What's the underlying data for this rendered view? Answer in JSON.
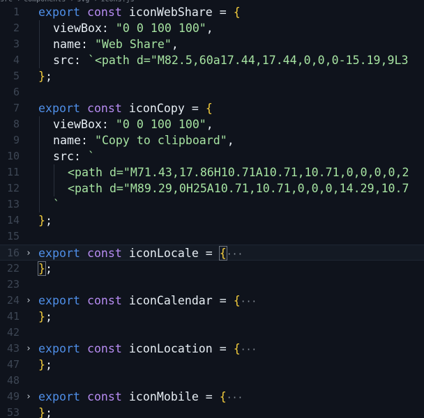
{
  "breadcrumb": [
    "src",
    "components",
    "svg",
    "icons.js"
  ],
  "lines": [
    {
      "n": "1",
      "tokens": [
        [
          "kw",
          "export"
        ],
        [
          "sp",
          " "
        ],
        [
          "kw2",
          "const"
        ],
        [
          "sp",
          " "
        ],
        [
          "ident",
          "iconWebShare"
        ],
        [
          "op",
          " = "
        ],
        [
          "brace",
          "{"
        ]
      ]
    },
    {
      "n": "2",
      "indent": 1,
      "tokens": [
        [
          "prop",
          "viewBox: "
        ],
        [
          "str",
          "\"0 0 100 100\""
        ],
        [
          "op",
          ","
        ]
      ]
    },
    {
      "n": "3",
      "indent": 1,
      "tokens": [
        [
          "prop",
          "name: "
        ],
        [
          "str",
          "\"Web Share\""
        ],
        [
          "op",
          ","
        ]
      ]
    },
    {
      "n": "4",
      "indent": 1,
      "tokens": [
        [
          "prop",
          "src: "
        ],
        [
          "str",
          "`<path d=\"M82.5,60a17.44,17.44,0,0,0-15.19,9L3"
        ]
      ]
    },
    {
      "n": "5",
      "tokens": [
        [
          "brace",
          "}"
        ],
        [
          "op",
          ";"
        ]
      ]
    },
    {
      "n": "6",
      "tokens": []
    },
    {
      "n": "7",
      "tokens": [
        [
          "kw",
          "export"
        ],
        [
          "sp",
          " "
        ],
        [
          "kw2",
          "const"
        ],
        [
          "sp",
          " "
        ],
        [
          "ident",
          "iconCopy"
        ],
        [
          "op",
          " = "
        ],
        [
          "brace",
          "{"
        ]
      ]
    },
    {
      "n": "8",
      "indent": 1,
      "tokens": [
        [
          "prop",
          "viewBox: "
        ],
        [
          "str",
          "\"0 0 100 100\""
        ],
        [
          "op",
          ","
        ]
      ]
    },
    {
      "n": "9",
      "indent": 1,
      "tokens": [
        [
          "prop",
          "name: "
        ],
        [
          "str",
          "\"Copy to clipboard\""
        ],
        [
          "op",
          ","
        ]
      ]
    },
    {
      "n": "10",
      "indent": 1,
      "tokens": [
        [
          "prop",
          "src: "
        ],
        [
          "str",
          "`"
        ]
      ]
    },
    {
      "n": "11",
      "indent": 2,
      "tokens": [
        [
          "str",
          "<path d=\"M71.43,17.86H10.71A10.71,10.71,0,0,0,0,2"
        ]
      ]
    },
    {
      "n": "12",
      "indent": 2,
      "tokens": [
        [
          "str",
          "<path d=\"M89.29,0H25A10.71,10.71,0,0,0,14.29,10.7"
        ]
      ]
    },
    {
      "n": "13",
      "indent": 1,
      "tokens": [
        [
          "str",
          "`"
        ]
      ]
    },
    {
      "n": "14",
      "tokens": [
        [
          "brace",
          "}"
        ],
        [
          "op",
          ";"
        ]
      ]
    },
    {
      "n": "15",
      "tokens": []
    },
    {
      "n": "16",
      "fold": true,
      "highlight": true,
      "tokens": [
        [
          "kw",
          "export"
        ],
        [
          "sp",
          " "
        ],
        [
          "kw2",
          "const"
        ],
        [
          "sp",
          " "
        ],
        [
          "ident",
          "iconLocale"
        ],
        [
          "op",
          " = "
        ],
        [
          "brace",
          "{"
        ],
        [
          "ell",
          "···"
        ]
      ]
    },
    {
      "n": "22",
      "tokens": [
        [
          "brace",
          "}"
        ],
        [
          "op",
          ";"
        ]
      ]
    },
    {
      "n": "23",
      "tokens": []
    },
    {
      "n": "24",
      "fold": true,
      "tokens": [
        [
          "kw",
          "export"
        ],
        [
          "sp",
          " "
        ],
        [
          "kw2",
          "const"
        ],
        [
          "sp",
          " "
        ],
        [
          "ident",
          "iconCalendar"
        ],
        [
          "op",
          " = "
        ],
        [
          "brace",
          "{"
        ],
        [
          "ell",
          "···"
        ]
      ]
    },
    {
      "n": "41",
      "tokens": [
        [
          "brace",
          "}"
        ],
        [
          "op",
          ";"
        ]
      ]
    },
    {
      "n": "42",
      "tokens": []
    },
    {
      "n": "43",
      "fold": true,
      "tokens": [
        [
          "kw",
          "export"
        ],
        [
          "sp",
          " "
        ],
        [
          "kw2",
          "const"
        ],
        [
          "sp",
          " "
        ],
        [
          "ident",
          "iconLocation"
        ],
        [
          "op",
          " = "
        ],
        [
          "brace",
          "{"
        ],
        [
          "ell",
          "···"
        ]
      ]
    },
    {
      "n": "47",
      "tokens": [
        [
          "brace",
          "}"
        ],
        [
          "op",
          ";"
        ]
      ]
    },
    {
      "n": "48",
      "tokens": []
    },
    {
      "n": "49",
      "fold": true,
      "tokens": [
        [
          "kw",
          "export"
        ],
        [
          "sp",
          " "
        ],
        [
          "kw2",
          "const"
        ],
        [
          "sp",
          " "
        ],
        [
          "ident",
          "iconMobile"
        ],
        [
          "op",
          " = "
        ],
        [
          "brace",
          "{"
        ],
        [
          "ell",
          "···"
        ]
      ]
    },
    {
      "n": "53",
      "tokens": [
        [
          "brace",
          "}"
        ],
        [
          "op",
          ";"
        ]
      ]
    }
  ],
  "colors": {
    "background": "#0f131c",
    "keyword": "#4f8fe8",
    "storage": "#b78cf2",
    "string": "#a6e3a1",
    "brace": "#f2cc3d",
    "line_number": "#3d4654"
  },
  "icons": {
    "fold": "chevron-right-icon"
  }
}
